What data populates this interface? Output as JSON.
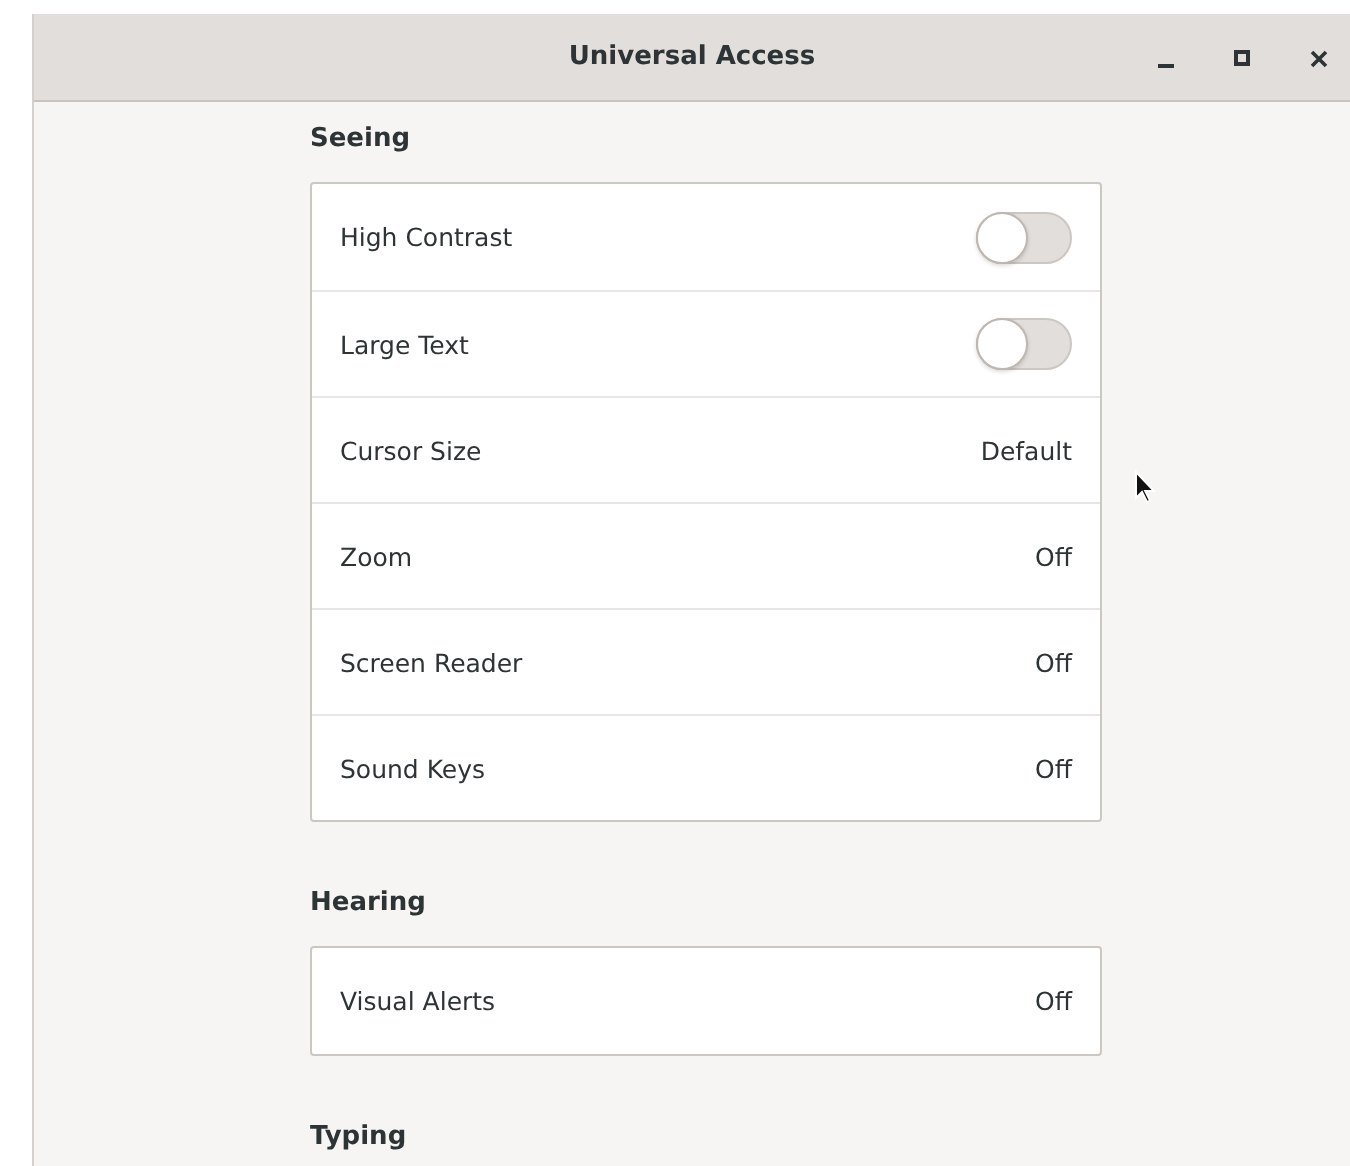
{
  "window": {
    "title": "Universal Access"
  },
  "sections": [
    {
      "heading": "Seeing",
      "rows": [
        {
          "label": "High Contrast",
          "kind": "switch",
          "on": false
        },
        {
          "label": "Large Text",
          "kind": "switch",
          "on": false
        },
        {
          "label": "Cursor Size",
          "kind": "value",
          "value": "Default"
        },
        {
          "label": "Zoom",
          "kind": "value",
          "value": "Off"
        },
        {
          "label": "Screen Reader",
          "kind": "value",
          "value": "Off"
        },
        {
          "label": "Sound Keys",
          "kind": "value",
          "value": "Off"
        }
      ]
    },
    {
      "heading": "Hearing",
      "rows": [
        {
          "label": "Visual Alerts",
          "kind": "value",
          "value": "Off"
        }
      ]
    },
    {
      "heading": "Typing"
    }
  ]
}
